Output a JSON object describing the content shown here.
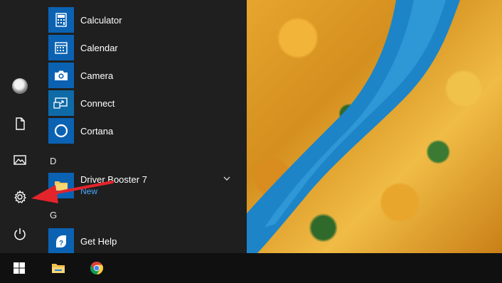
{
  "rail": {
    "items": [
      {
        "name": "account",
        "icon": "user-avatar-icon"
      },
      {
        "name": "documents",
        "icon": "document-icon"
      },
      {
        "name": "pictures",
        "icon": "pictures-icon"
      },
      {
        "name": "settings",
        "icon": "gear-icon"
      },
      {
        "name": "power",
        "icon": "power-icon"
      }
    ]
  },
  "apps": {
    "calculator": {
      "label": "Calculator",
      "icon": "calculator-icon"
    },
    "calendar": {
      "label": "Calendar",
      "icon": "calendar-icon"
    },
    "camera": {
      "label": "Camera",
      "icon": "camera-icon"
    },
    "connect": {
      "label": "Connect",
      "icon": "connect-icon"
    },
    "cortana": {
      "label": "Cortana",
      "icon": "cortana-icon"
    },
    "section_d": "D",
    "driver_booster": {
      "label": "Driver Booster 7",
      "badge": "New",
      "icon": "folder-icon"
    },
    "section_g": "G",
    "get_help": {
      "label": "Get Help",
      "icon": "get-help-icon"
    }
  },
  "taskbar": {
    "items": [
      {
        "name": "start",
        "icon": "windows-logo-icon"
      },
      {
        "name": "file-explorer",
        "icon": "folder-icon"
      },
      {
        "name": "chrome",
        "icon": "chrome-icon"
      }
    ]
  },
  "colors": {
    "tile_blue": "#0b62b3",
    "badge_blue": "#4aa6ff",
    "arrow_red": "#e4242b",
    "panel_bg": "#1f1f1f",
    "taskbar_bg": "#101010"
  }
}
